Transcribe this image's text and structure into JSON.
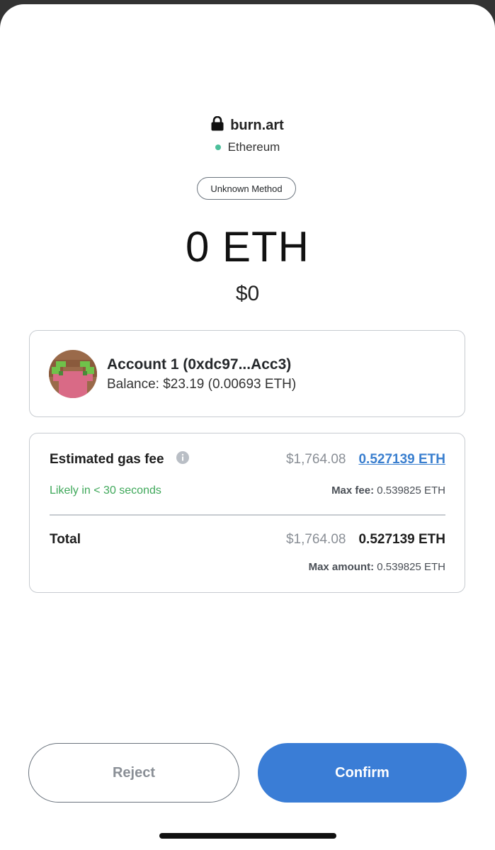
{
  "header": {
    "origin": "burn.art",
    "lock_icon": "lock-icon",
    "network": "Ethereum",
    "network_dot_color": "#4cbf9b"
  },
  "method_label": "Unknown Method",
  "amount": {
    "value": "0 ETH",
    "fiat": "$0"
  },
  "account": {
    "name": "Account 1 (0xdc97...Acc3)",
    "balance": "Balance: $23.19 (0.00693 ETH)"
  },
  "gas": {
    "label": "Estimated gas fee",
    "info_icon": "info-icon",
    "fiat": "$1,764.08",
    "eth": "0.527139 ETH",
    "likely": "Likely in < 30 seconds",
    "max_fee_label": "Max fee:",
    "max_fee_value": "0.539825 ETH"
  },
  "total": {
    "label": "Total",
    "fiat": "$1,764.08",
    "eth": "0.527139 ETH",
    "max_amount_label": "Max amount:",
    "max_amount_value": "0.539825 ETH"
  },
  "buttons": {
    "reject": "Reject",
    "confirm": "Confirm"
  },
  "colors": {
    "accent": "#3a7dd6",
    "link": "#3a7fcf",
    "success": "#3fa85a"
  }
}
